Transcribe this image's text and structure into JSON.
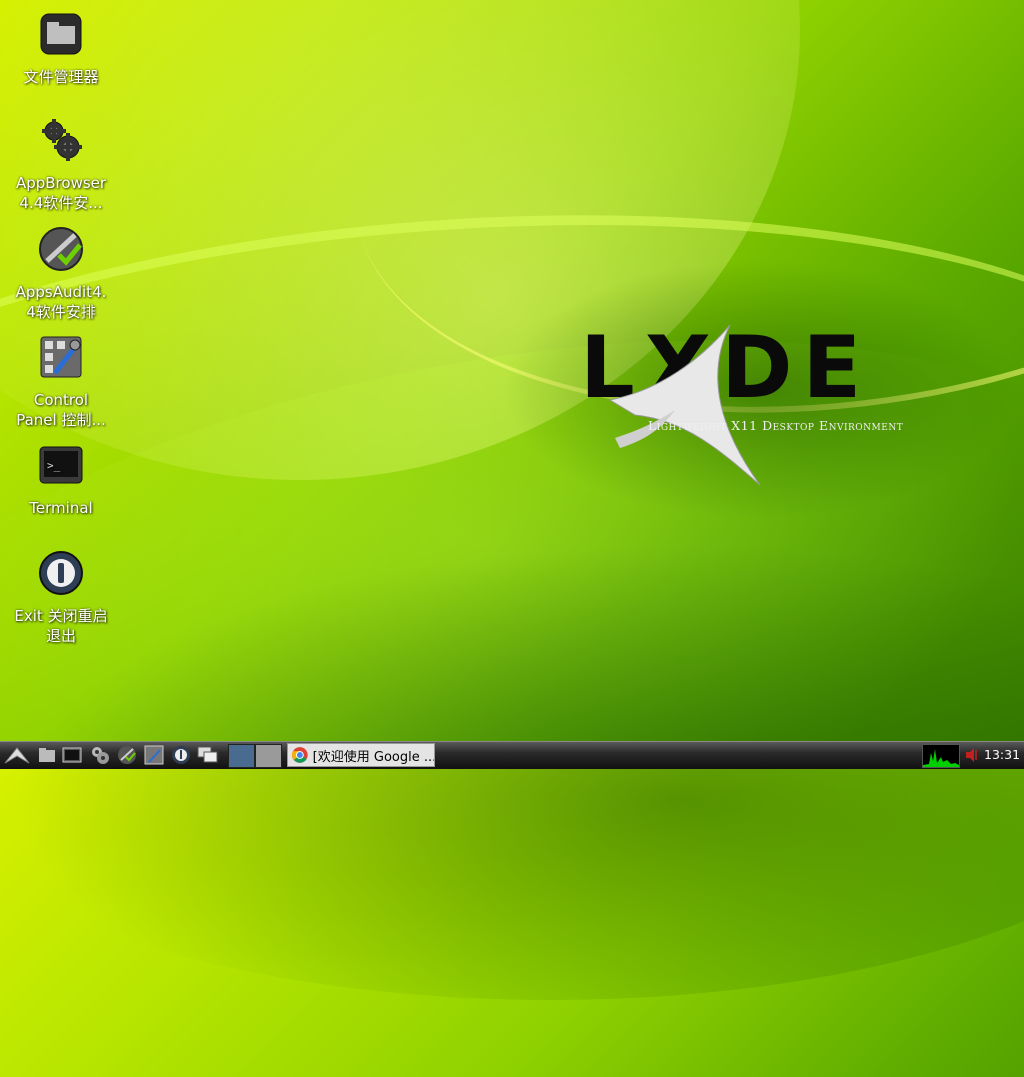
{
  "desktop": {
    "icons": [
      {
        "label_line1": "文件管理器",
        "label_line2": "",
        "icon": "file-manager-icon"
      },
      {
        "label_line1": "AppBrowser",
        "label_line2": "4.4软件安...",
        "icon": "gears-icon"
      },
      {
        "label_line1": "AppsAudit4.",
        "label_line2": "4软件安排",
        "icon": "apps-audit-icon"
      },
      {
        "label_line1": "Control",
        "label_line2": "Panel 控制...",
        "icon": "control-panel-icon"
      },
      {
        "label_line1": "Terminal",
        "label_line2": "",
        "icon": "terminal-icon"
      },
      {
        "label_line1": "Exit 关闭重启",
        "label_line2": "退出",
        "icon": "power-icon"
      }
    ]
  },
  "wallpaper": {
    "logo_text": "LXDE",
    "logo_subtitle": "Lightweight X11 Desktop Environment"
  },
  "taskbar": {
    "task": {
      "title": "[欢迎使用 Google ...",
      "icon": "chrome-icon"
    },
    "clock": "13:31",
    "launchers": [
      "menu-icon",
      "file-manager-icon",
      "terminal-icon",
      "gears-icon",
      "apps-audit-icon",
      "control-panel-icon",
      "power-icon",
      "windows-icon"
    ]
  },
  "colors": {
    "accent": "#9cd600",
    "panel": "#1e1e1e"
  }
}
